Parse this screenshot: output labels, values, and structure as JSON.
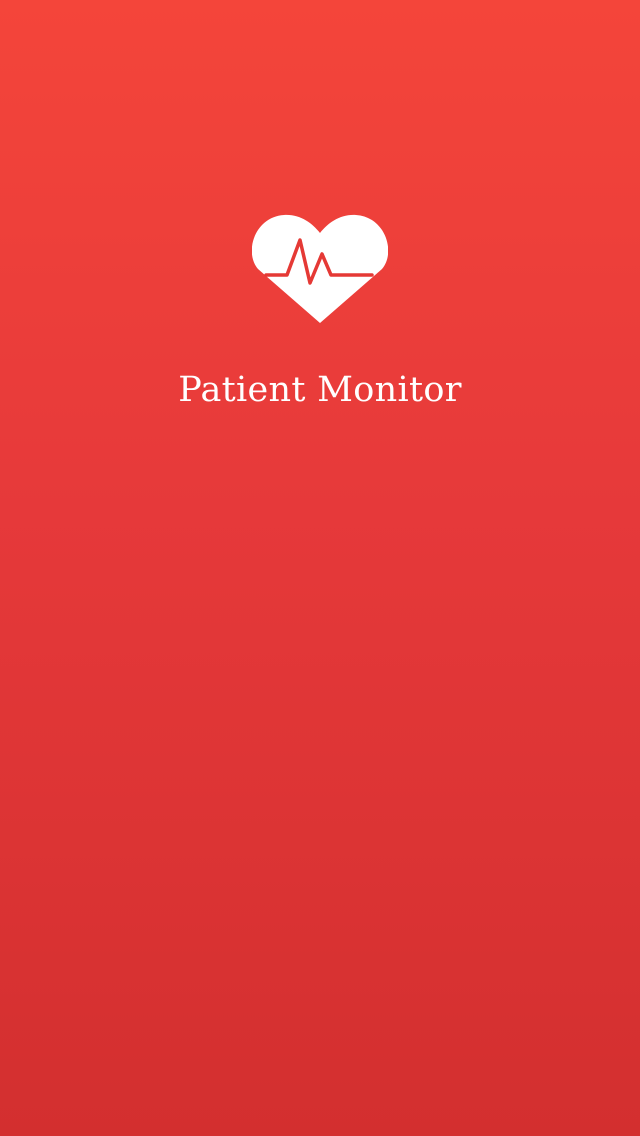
{
  "app": {
    "title": "Patient Monitor",
    "logo_icon": "heart-pulse-icon"
  },
  "colors": {
    "background_top": "#f4453a",
    "background_bottom": "#d32f2f",
    "foreground": "#ffffff",
    "pulse_line": "#e53935"
  }
}
